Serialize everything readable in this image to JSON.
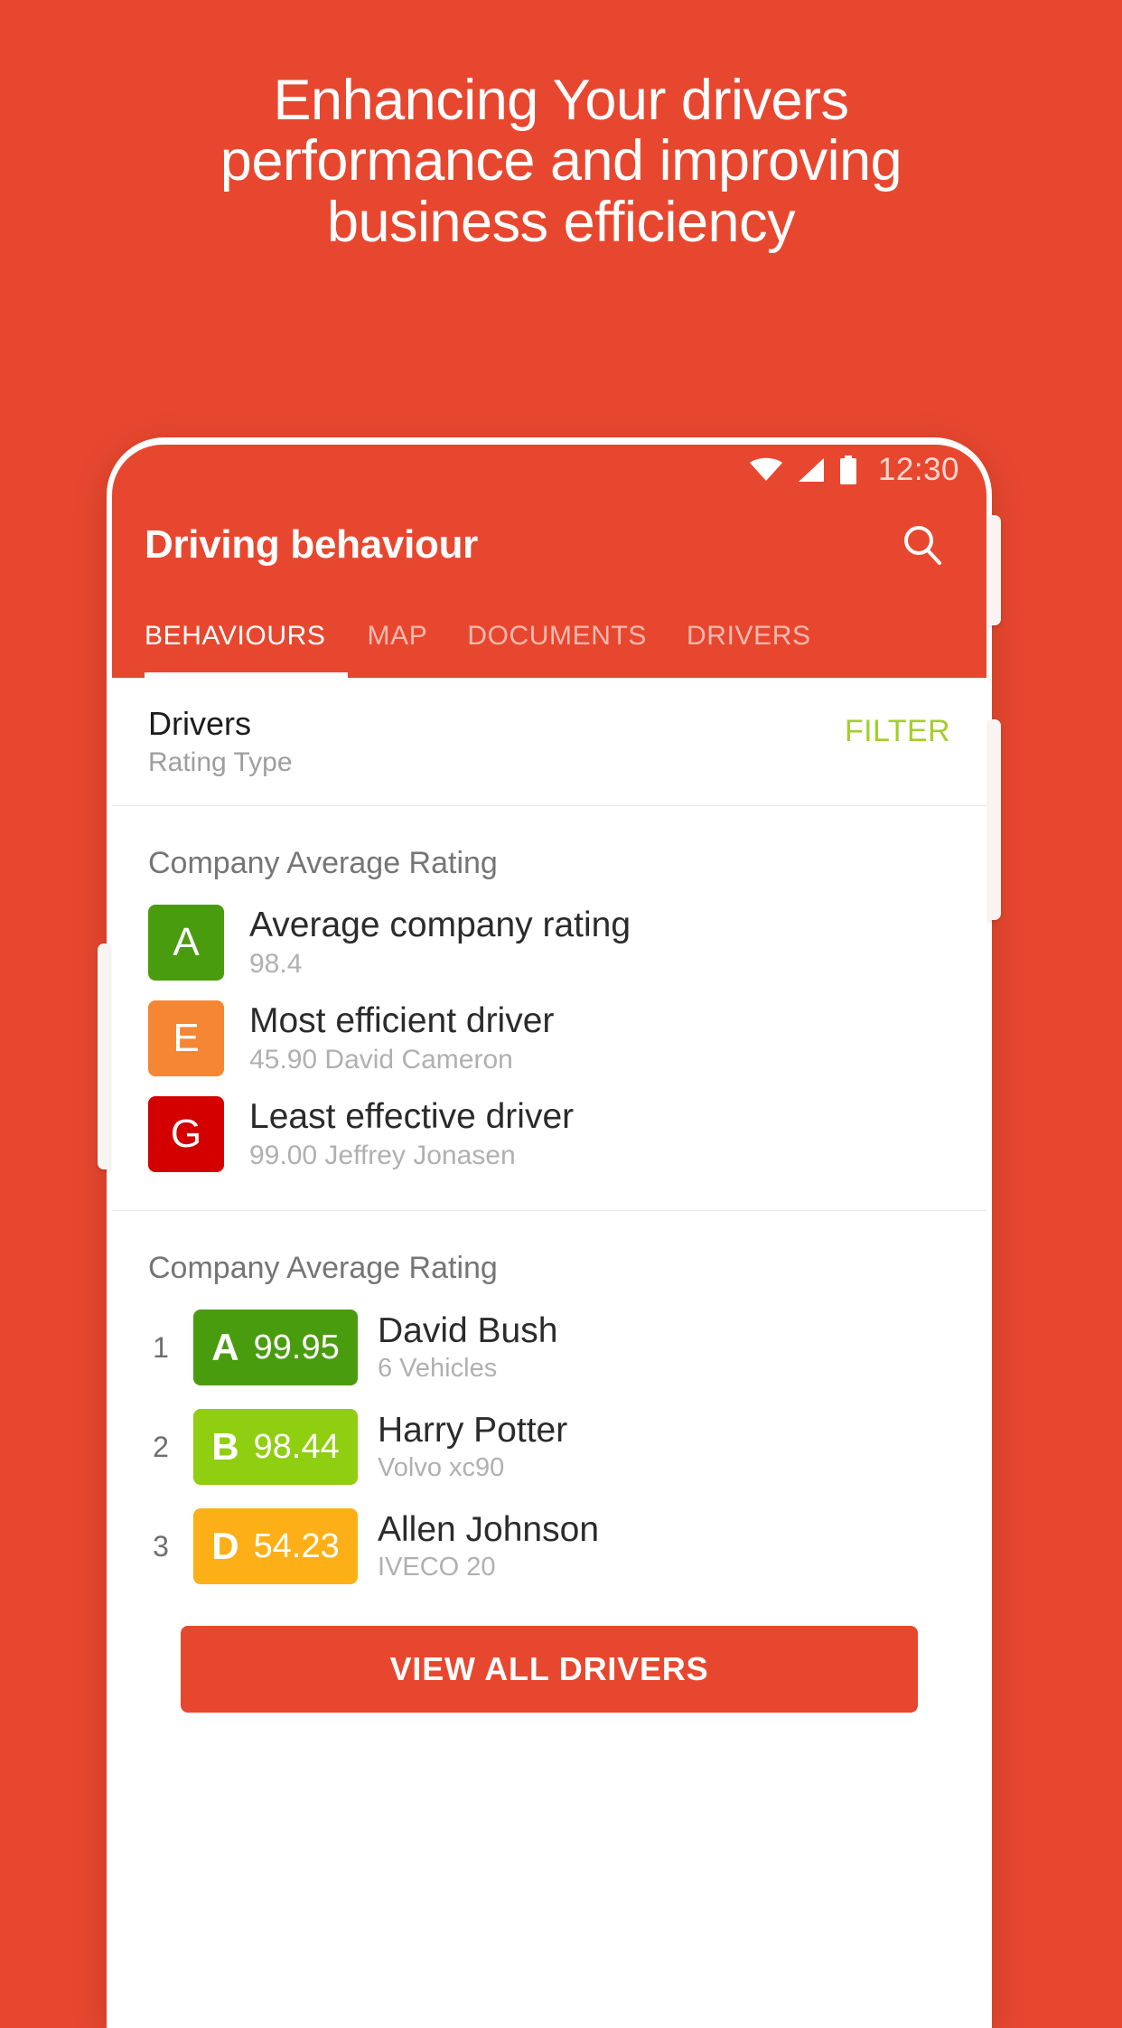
{
  "hero": {
    "lines": [
      "Enhancing Your drivers",
      "performance and improving",
      "business efficiency"
    ]
  },
  "colors": {
    "brand": "#e8472f",
    "filter_green": "#a4ce2c",
    "grade_a": "#4a9c0f",
    "grade_b": "#8fce10",
    "grade_d": "#fcaf17",
    "grade_e": "#f58634",
    "grade_g": "#d40000"
  },
  "statusbar": {
    "time": "12:30",
    "icons": [
      "wifi-icon",
      "signal-icon",
      "battery-icon"
    ]
  },
  "appbar": {
    "title": "Driving behaviour",
    "search_icon": "search-icon"
  },
  "tabs": [
    {
      "label": "BEHAVIOURS",
      "active": true
    },
    {
      "label": "MAP",
      "active": false
    },
    {
      "label": "DOCUMENTS",
      "active": false
    },
    {
      "label": "DRIVERS",
      "active": false
    }
  ],
  "filter_row": {
    "title": "Drivers",
    "subtitle": "Rating Type",
    "filter_label": "FILTER"
  },
  "summary_section": {
    "title": "Company Average Rating",
    "rows": [
      {
        "grade": "A",
        "color": "#4a9c0f",
        "label": "Average company rating",
        "value": "98.4"
      },
      {
        "grade": "E",
        "color": "#f58634",
        "label": "Most efficient driver",
        "value": "45.90 David Cameron"
      },
      {
        "grade": "G",
        "color": "#d40000",
        "label": "Least effective driver",
        "value": "99.00 Jeffrey Jonasen"
      }
    ]
  },
  "ranking_section": {
    "title": "Company Average Rating",
    "rows": [
      {
        "rank": "1",
        "grade": "A",
        "score": "99.95",
        "color": "#4a9c0f",
        "name": "David Bush",
        "detail": "6 Vehicles"
      },
      {
        "rank": "2",
        "grade": "B",
        "score": "98.44",
        "color": "#8fce10",
        "name": "Harry Potter",
        "detail": "Volvo xc90"
      },
      {
        "rank": "3",
        "grade": "D",
        "score": "54.23",
        "color": "#fcaf17",
        "name": "Allen Johnson",
        "detail": "IVECO 20"
      }
    ],
    "view_all_label": "VIEW ALL DRIVERS"
  }
}
